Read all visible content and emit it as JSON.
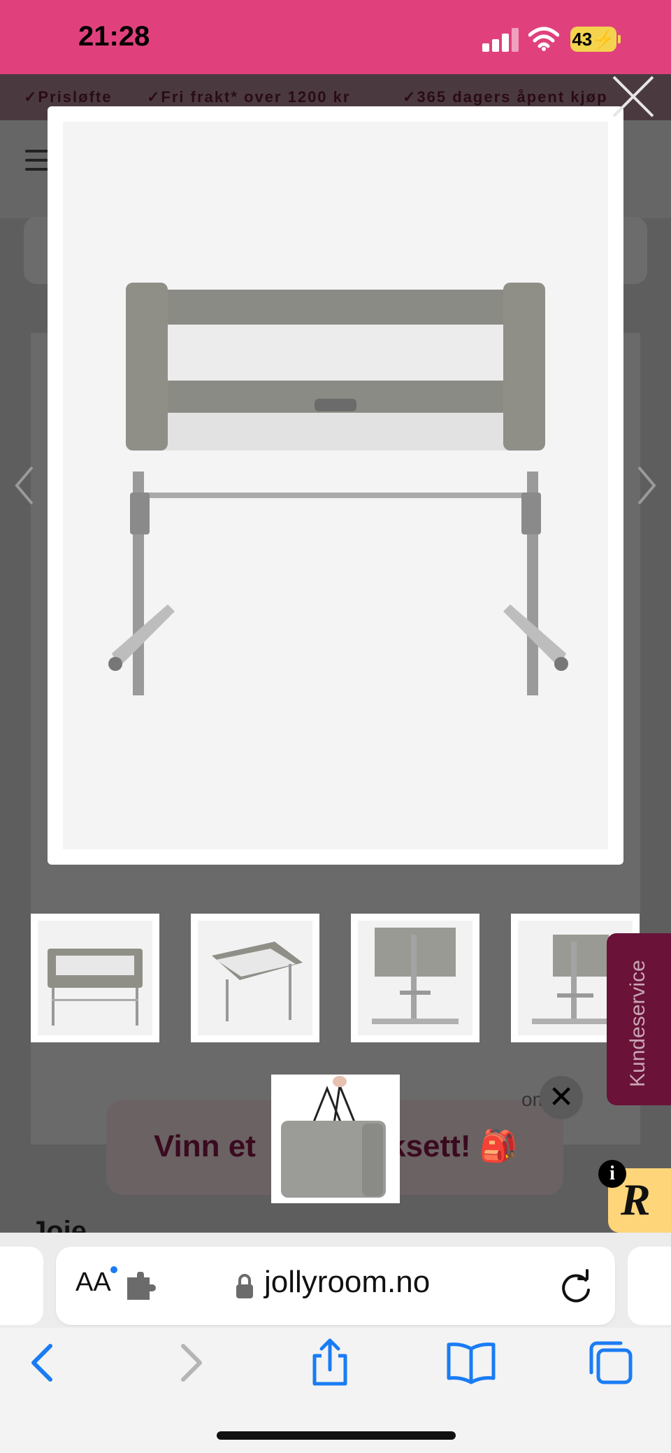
{
  "status_bar": {
    "time": "21:28",
    "battery_level": "43"
  },
  "promo_bar": {
    "items": [
      "✓Prisløfte",
      "✓Fri frakt* over 1200 kr",
      "✓365 dagers åpent kjøp"
    ]
  },
  "gallery": {
    "main_image_alt": "Joie bedside crib front view",
    "thumbnails": [
      "crib-front",
      "crib-angled",
      "crib-side-back",
      "crib-side-back-2"
    ],
    "bag_thumbnail": "carry-bag"
  },
  "side_tab": {
    "label": "Kundeservice"
  },
  "banner": {
    "text_left": "Vinn et ",
    "text_right": "ksett! 🎒",
    "close_label": "✕",
    "behind_text": "om"
  },
  "brand_badge": {
    "letter": "R",
    "info": "i"
  },
  "product": {
    "brand_partial": "Joie"
  },
  "browser": {
    "aa_label": "AA",
    "url": "jollyroom.no"
  },
  "colors": {
    "status_bar": "#e0417d",
    "accent_blue": "#1a7cf4",
    "kundeservice": "#6a1237",
    "badge": "#ffd57a"
  }
}
